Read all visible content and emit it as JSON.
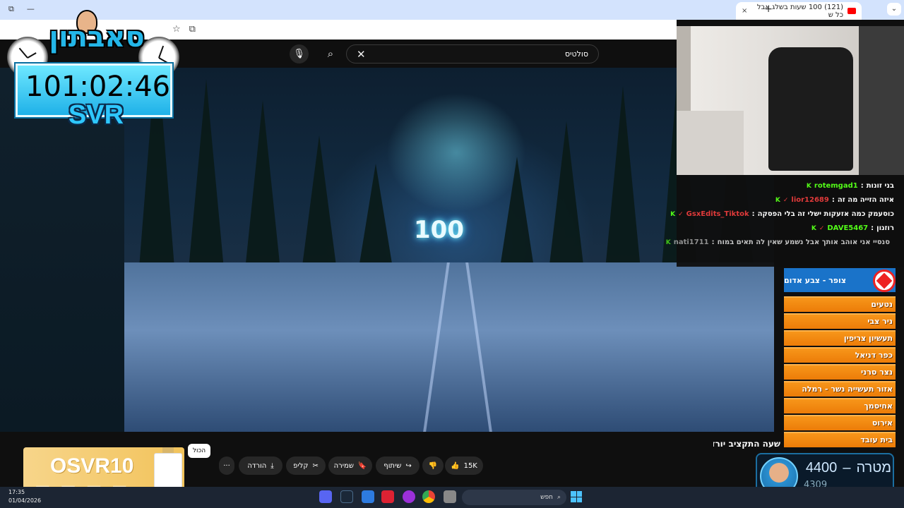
{
  "browser": {
    "tab_title": "(121) 100 שעות בשלג אבל כל ש",
    "tab_close": "×",
    "new_tab": "+",
    "window_controls": [
      "⧉",
      "—"
    ],
    "tab_menu": "⌄"
  },
  "youtube": {
    "search_value": "סולטיס",
    "search_clear": "✕",
    "video_overlay_text": "100",
    "title_fragment": "שעה התקציב יורד",
    "actions": {
      "likes": "15K",
      "share": "שיתוף",
      "save": "שמירה",
      "clip": "קליפ",
      "download": "הורדה",
      "more": "···"
    },
    "chip_all": "הכול"
  },
  "promo": {
    "code": "OSVR10"
  },
  "overlay": {
    "brand": "סאבתון",
    "timer": "101:02:46",
    "tag": "SVR"
  },
  "chat": [
    {
      "user": "rotemgad1",
      "message": "בני זונות",
      "user_color": "#53fc18",
      "verified": false
    },
    {
      "user": "lior12689",
      "message": "איזה הזייה מה זה",
      "user_color": "#e03a3a",
      "verified": true
    },
    {
      "user": "GsxEdits_Tiktok",
      "message": "כוסעמק כמה אזעקות ישלי זה בלי הפסקה",
      "user_color": "#e03a3a",
      "verified": true
    },
    {
      "user": "DAVE5467",
      "message": "רוזנון",
      "user_color": "#53fc18",
      "verified": true
    },
    {
      "user": "nati1711",
      "message": "סנסיי אני אוהב אותך אבל נשמע שאין לה תאים במוח",
      "user_color": "#bbbbbb",
      "verified": false
    }
  ],
  "alerts": {
    "header": "צופר - צבע אדום",
    "towns": [
      "נטעים",
      "ניר צבי",
      "תעשיון צריפין",
      "כפר דניאל",
      "נצר סרני",
      "אזור תעשייה נשר - רמלה",
      "אחיסמך",
      "אירוס",
      "בית עובד"
    ]
  },
  "goal": {
    "label": "מטרה",
    "separator": "–",
    "target": "4400",
    "current": "4309"
  },
  "taskbar": {
    "time": "17:35",
    "date": "01/04/2026",
    "search_placeholder": "חפש"
  }
}
